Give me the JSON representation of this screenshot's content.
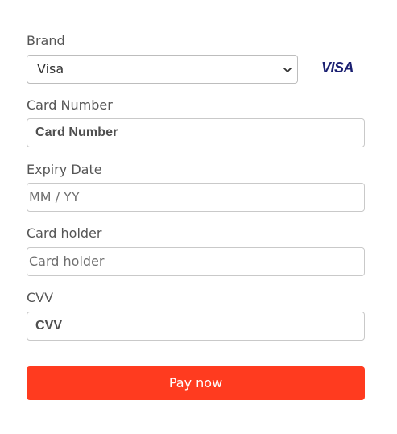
{
  "brand": {
    "label": "Brand",
    "selected": "Visa",
    "logo_text": "VISA",
    "logo_color": "#1a1f71"
  },
  "card_number": {
    "label": "Card Number",
    "placeholder": "Card Number"
  },
  "expiry": {
    "label": "Expiry Date",
    "placeholder": "MM / YY"
  },
  "holder": {
    "label": "Card holder",
    "placeholder": "Card holder"
  },
  "cvv": {
    "label": "CVV",
    "placeholder": "CVV"
  },
  "pay": {
    "label": "Pay now",
    "color": "#ff3b1f"
  },
  "icons": {
    "select_arrow": "chevron-down-icon",
    "brand": "visa-logo"
  }
}
